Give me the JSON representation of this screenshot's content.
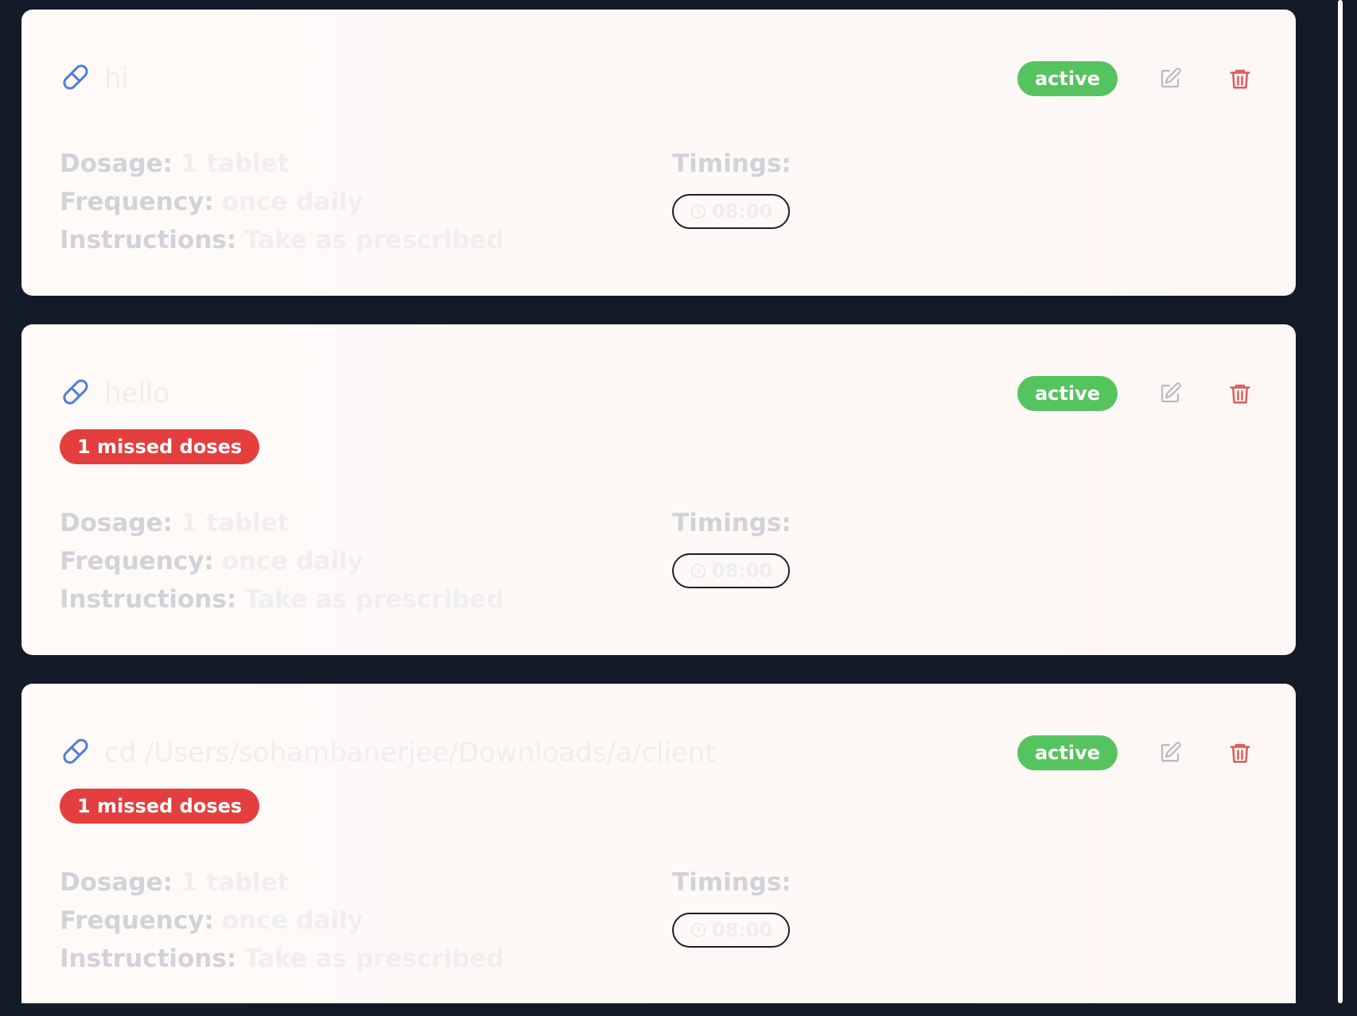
{
  "medications": [
    {
      "name": "hi",
      "status": "active",
      "missed": "",
      "dosage_label": "Dosage:",
      "dosage_value": "1 tablet",
      "frequency_label": "Frequency:",
      "frequency_value": "once daily",
      "instructions_label": "Instructions:",
      "instructions_value": "Take as prescribed",
      "timings_label": "Timings:",
      "timings": [
        "08:00"
      ]
    },
    {
      "name": "hello",
      "status": "active",
      "missed": "1 missed doses",
      "dosage_label": "Dosage:",
      "dosage_value": "1 tablet",
      "frequency_label": "Frequency:",
      "frequency_value": "once daily",
      "instructions_label": "Instructions:",
      "instructions_value": "Take as prescribed",
      "timings_label": "Timings:",
      "timings": [
        "08:00"
      ]
    },
    {
      "name": "cd /Users/sohambanerjee/Downloads/a/client",
      "status": "active",
      "missed": "1 missed doses",
      "dosage_label": "Dosage:",
      "dosage_value": "1 tablet",
      "frequency_label": "Frequency:",
      "frequency_value": "once daily",
      "instructions_label": "Instructions:",
      "instructions_value": "Take as prescribed",
      "timings_label": "Timings:",
      "timings": [
        "08:00"
      ]
    }
  ],
  "icons": {
    "medication": "pill-icon",
    "edit": "edit-icon",
    "delete": "trash-icon",
    "time": "clock-icon"
  },
  "colors": {
    "background": "#131a28",
    "card": "#fffaf8",
    "active": "#55c45f",
    "missed": "#e53e3e",
    "pill": "#4f7ed8",
    "delete": "#dd5b5b",
    "edit": "#b7bac0"
  }
}
